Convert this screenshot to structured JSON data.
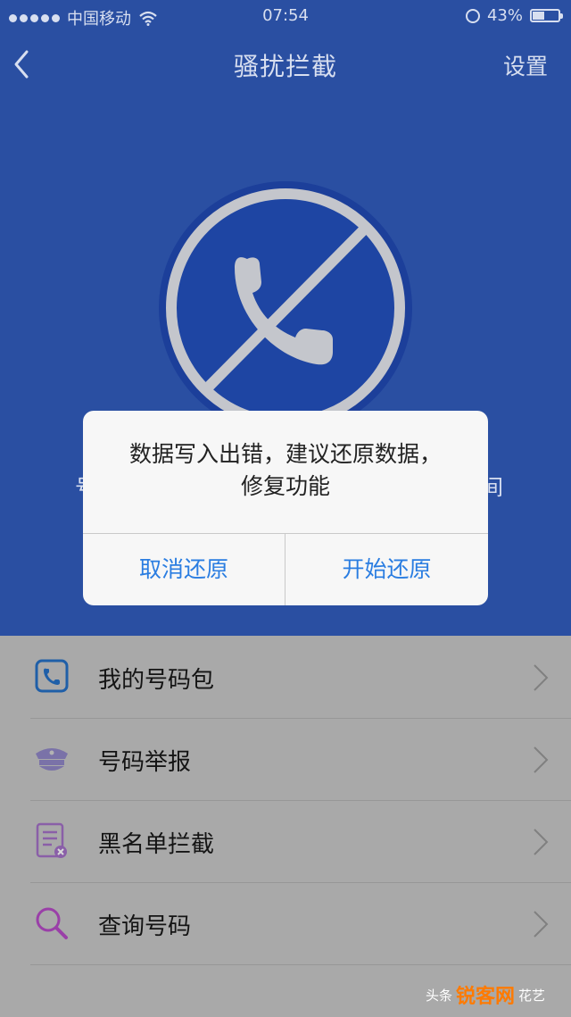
{
  "status_bar": {
    "carrier": "中国移动",
    "time": "07:54",
    "battery": "43%"
  },
  "navbar": {
    "title": "骚扰拦截",
    "settings_label": "设置"
  },
  "background_text": {
    "left_fragment": "号",
    "right_fragment": "间"
  },
  "dialog": {
    "message": "数据写入出错，建议还原数据，修复功能",
    "cancel_label": "取消还原",
    "confirm_label": "开始还原"
  },
  "menu": {
    "items": [
      {
        "label": "我的号码包",
        "icon": "phone-book-icon"
      },
      {
        "label": "号码举报",
        "icon": "police-cap-icon"
      },
      {
        "label": "黑名单拦截",
        "icon": "blacklist-icon"
      },
      {
        "label": "查询号码",
        "icon": "search-icon"
      }
    ]
  },
  "watermark": {
    "prefix": "头条",
    "brand": "锐客网",
    "suffix": "花艺"
  },
  "colors": {
    "header_blue": "#2a4fa2",
    "emblem_blue": "#1c3f9a",
    "dialog_button_blue": "#2a7de1",
    "overlay_gray": "#a9a9a9"
  }
}
